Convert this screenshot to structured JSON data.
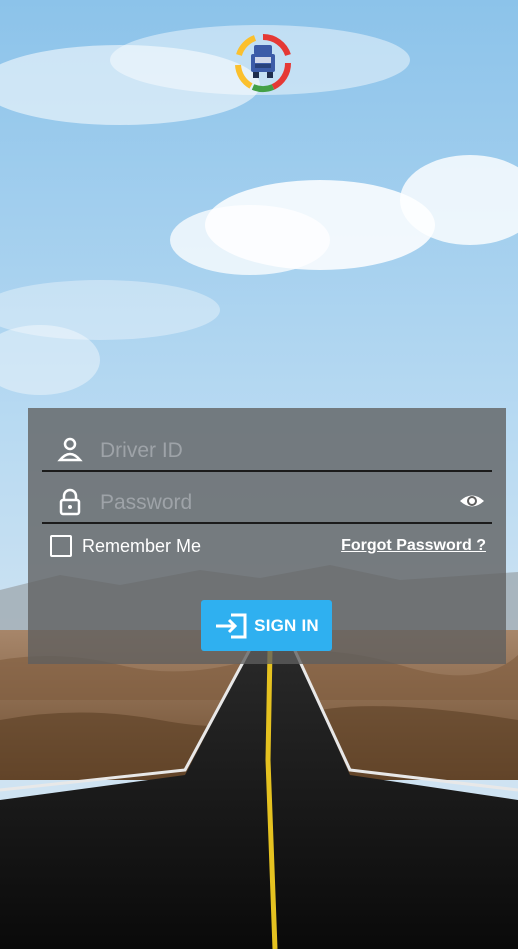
{
  "form": {
    "driver_id_placeholder": "Driver ID",
    "password_placeholder": "Password",
    "remember_label": "Remember Me",
    "forgot_label": "Forgot Password ?",
    "signin_label": "SIGN IN"
  },
  "icons": {
    "driver": "person-icon",
    "password": "lock-icon",
    "toggle_password": "eye-icon",
    "signin": "sign-in-icon",
    "logo": "truck-logo"
  },
  "colors": {
    "accent": "#2fb0f0",
    "panel": "#5f5f5f",
    "field_line": "#1b1b1b"
  }
}
